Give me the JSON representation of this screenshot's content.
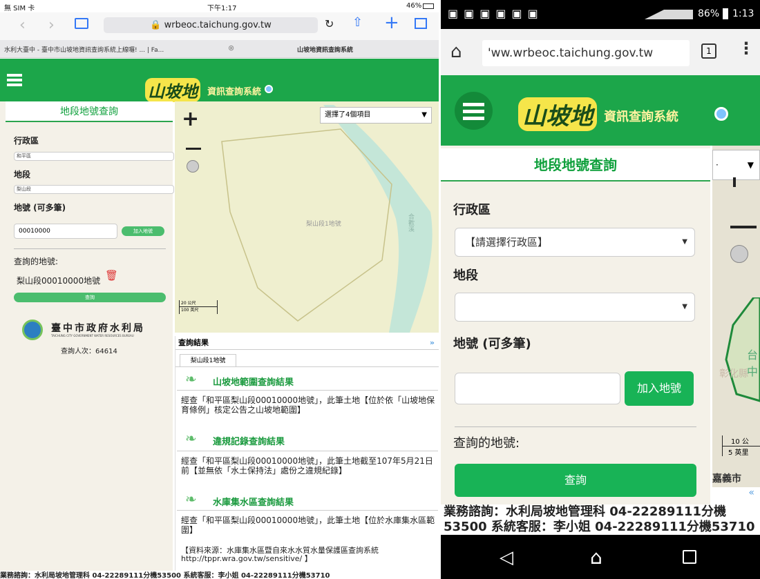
{
  "ipad": {
    "status": {
      "carrier": "無 SIM 卡",
      "time": "下午1:17",
      "battery": "46%"
    },
    "url": "wrbeoc.taichung.gov.tw",
    "tabs": [
      "水利大臺中 - 臺中市山坡地資訊查詢系統上線囉! ... | Fa...",
      "山坡地資訊查詢系統"
    ],
    "banner": {
      "logo": "山坡地",
      "subtitle": "資訊查詢系統"
    },
    "panel": {
      "title": "地段地號查詢",
      "district_label": "行政區",
      "district_value": "和平區",
      "section_label": "地段",
      "section_value": "梨山段",
      "lotno_label": "地號 (可多筆)",
      "lotno_value": "00010000",
      "add_button": "加入地號",
      "queried_label": "查詢的地號:",
      "queried_item": "梨山段00010000地號",
      "query_button": "查詢",
      "org_name": "臺中市政府水利局",
      "org_eng": "TAICHUNG CITY GOVERNMENT WATER RESOURCES BUREAU",
      "visitors": "查詢人次：64614"
    },
    "map": {
      "layer_select": "選擇了4個項目",
      "parcel_label": "梨山段1地號",
      "river_label": "合歡溪",
      "scale_m": "20 公尺",
      "scale_ft": "100 英尺"
    },
    "results": {
      "header": "查詢結果",
      "tab": "梨山段1地號",
      "sections": [
        {
          "title": "山坡地範圍查詢結果",
          "text": "經查「和平區梨山段00010000地號」，此筆土地【位於依「山坡地保育條例」核定公告之山坡地範圍】"
        },
        {
          "title": "違規記錄查詢結果",
          "text": "經查「和平區梨山段00010000地號」，此筆土地截至107年5月21日前【並無依「水土保持法」處份之違規紀錄】"
        },
        {
          "title": "水庫集水區查詢結果",
          "text": "經查「和平區梨山段00010000地號」，此筆土地【位於水庫集水區範圍】"
        }
      ],
      "source": "【資料來源：水庫集水區暨自來水水質水量保護區查詢系統 http://tppr.wra.gov.tw/sensitive/ 】"
    },
    "footer": "業務諮詢：水利局坡地管理科 04-22289111分機53500 系統客服：李小姐 04-22289111分機53710"
  },
  "android": {
    "status": {
      "battery": "86%",
      "time": "1:13"
    },
    "url": "'ww.wrbeoc.taichung.gov.tw",
    "tab_count": "1",
    "banner": {
      "logo": "山坡地",
      "subtitle": "資訊查詢系統"
    },
    "panel": {
      "title": "地段地號查詢",
      "district_label": "行政區",
      "district_value": "【請選擇行政區】",
      "section_label": "地段",
      "section_value": "",
      "lotno_label": "地號 (可多筆)",
      "add_button": "加入地號",
      "queried_label": "查詢的地號:",
      "query_button": "查詢"
    },
    "map": {
      "place1": "台中",
      "place2": "彰化縣",
      "place3": "嘉義市",
      "scale_m": "10 公",
      "scale_ft": "5 英里"
    },
    "footer": "業務諮詢：水利局坡地管理科 04-22289111分機53500 系統客服：李小姐 04-22289111分機53710"
  },
  "colors": {
    "brand_green": "#1ca64a",
    "title_green": "#0fa03c",
    "button_green": "#18b356"
  }
}
